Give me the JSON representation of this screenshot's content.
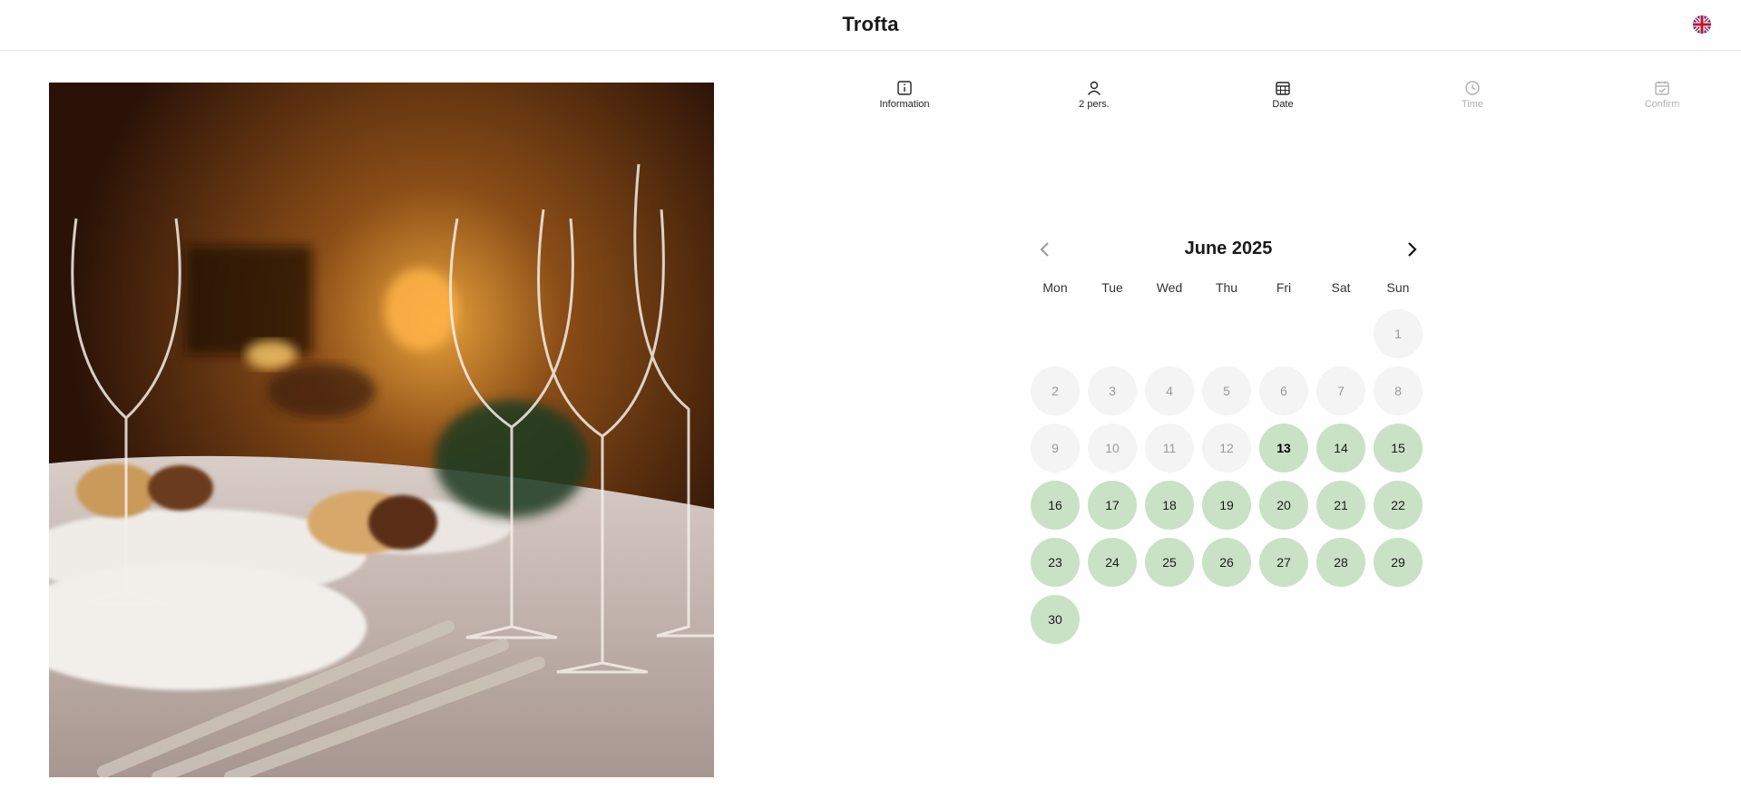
{
  "header": {
    "brand": "Trofta",
    "language_icon": "uk-flag-icon"
  },
  "steps": [
    {
      "id": "information",
      "label": "Information",
      "icon": "info-icon",
      "state": "done"
    },
    {
      "id": "guests",
      "label": "2 pers.",
      "icon": "person-icon",
      "state": "done"
    },
    {
      "id": "date",
      "label": "Date",
      "icon": "calendar-icon",
      "state": "active"
    },
    {
      "id": "time",
      "label": "Time",
      "icon": "clock-icon",
      "state": "disabled"
    },
    {
      "id": "confirm",
      "label": "Confirm",
      "icon": "calendar-check-icon",
      "state": "disabled"
    }
  ],
  "calendar": {
    "month_label": "June 2025",
    "weekdays": [
      "Mon",
      "Tue",
      "Wed",
      "Thu",
      "Fri",
      "Sat",
      "Sun"
    ],
    "first_weekday_index": 6,
    "today": 13,
    "days": [
      {
        "n": "1",
        "available": false
      },
      {
        "n": "2",
        "available": false
      },
      {
        "n": "3",
        "available": false
      },
      {
        "n": "4",
        "available": false
      },
      {
        "n": "5",
        "available": false
      },
      {
        "n": "6",
        "available": false
      },
      {
        "n": "7",
        "available": false
      },
      {
        "n": "8",
        "available": false
      },
      {
        "n": "9",
        "available": false
      },
      {
        "n": "10",
        "available": false
      },
      {
        "n": "11",
        "available": false
      },
      {
        "n": "12",
        "available": false
      },
      {
        "n": "13",
        "available": true
      },
      {
        "n": "14",
        "available": true
      },
      {
        "n": "15",
        "available": true
      },
      {
        "n": "16",
        "available": true
      },
      {
        "n": "17",
        "available": true
      },
      {
        "n": "18",
        "available": true
      },
      {
        "n": "19",
        "available": true
      },
      {
        "n": "20",
        "available": true
      },
      {
        "n": "21",
        "available": true
      },
      {
        "n": "22",
        "available": true
      },
      {
        "n": "23",
        "available": true
      },
      {
        "n": "24",
        "available": true
      },
      {
        "n": "25",
        "available": true
      },
      {
        "n": "26",
        "available": true
      },
      {
        "n": "27",
        "available": true
      },
      {
        "n": "28",
        "available": true
      },
      {
        "n": "29",
        "available": true
      },
      {
        "n": "30",
        "available": true
      }
    ]
  },
  "colors": {
    "available": "#c9e2c5",
    "unavailable": "#f4f4f4",
    "disabled_text": "#b0b0b0"
  }
}
